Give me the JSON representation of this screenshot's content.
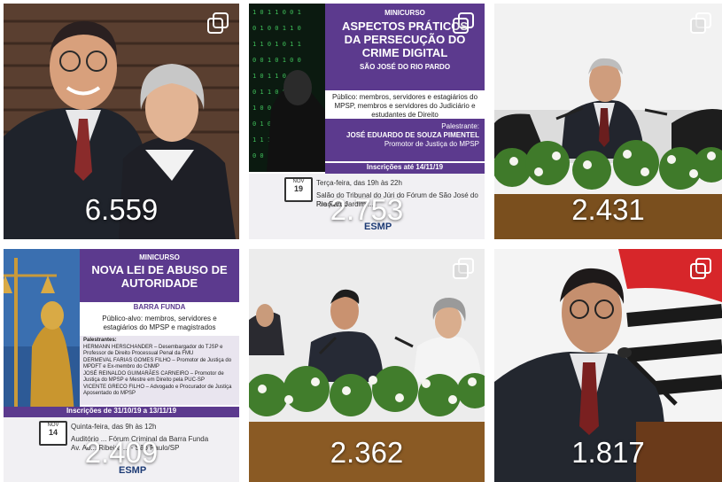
{
  "grid": {
    "posts": [
      {
        "count": "6.559",
        "multi": true
      },
      {
        "count": "2.753",
        "multi": true,
        "poster": {
          "kicker": "MINICURSO",
          "title": "ASPECTOS PRÁTICOS DA PERSECUÇÃO DO CRIME DIGITAL",
          "city": "SÃO JOSÉ DO RIO PARDO",
          "audience": "Público: membros, servidores e estagiários do MPSP, membros e servidores do Judiciário e estudantes de Direito",
          "speaker_label": "Palestrante:",
          "speaker_name": "JOSÉ EDUARDO DE SOUZA PIMENTEL",
          "speaker_role": "Promotor de Justiça do MPSP",
          "registration": "Inscrições até 14/11/19",
          "cal_month": "NOV",
          "cal_day": "19",
          "when": "Terça-feira, das 19h às 22h",
          "where_line1": "Salão do Tribunal do Júri do Fórum de São José do Rio Pardo",
          "where_line2": "Praça ... Jardim ...",
          "logo": "ESMP"
        }
      },
      {
        "count": "2.431",
        "multi": true
      },
      {
        "count": "2.409",
        "multi": false,
        "poster": {
          "kicker": "MINICURSO",
          "title": "NOVA LEI DE ABUSO DE AUTORIDADE",
          "city": "BARRA FUNDA",
          "audience": "Público-alvo: membros, servidores e estagiários do MPSP e magistrados",
          "speakers_label": "Palestrantes:",
          "speakers": [
            "HERMANN HERSCHANDER – Desembargador do TJSP e Professor de Direito Processual Penal da FMU",
            "DERMEVAL FARIAS GOMES FILHO – Promotor de Justiça do MPDFT e Ex-membro do CNMP",
            "JOSÉ REINALDO GUIMARÃES CARNEIRO – Promotor de Justiça do MPSP e Mestre em Direito pela PUC-SP",
            "VICENTE GRECO FILHO – Advogado e Procurador de Justiça Aposentado do MPSP"
          ],
          "registration": "Inscrições de 31/10/19 a 13/11/19",
          "cal_month": "NOV",
          "cal_day": "14",
          "when": "Quinta-feira, das 9h às 12h",
          "where_line1": "Auditório ... Fórum Criminal da Barra Funda",
          "where_line2": "Av. Ab... Ribeiro ... - São Paulo/SP",
          "logo": "ESMP"
        }
      },
      {
        "count": "2.362",
        "multi": true
      },
      {
        "count": "1.817",
        "multi": true
      }
    ]
  }
}
